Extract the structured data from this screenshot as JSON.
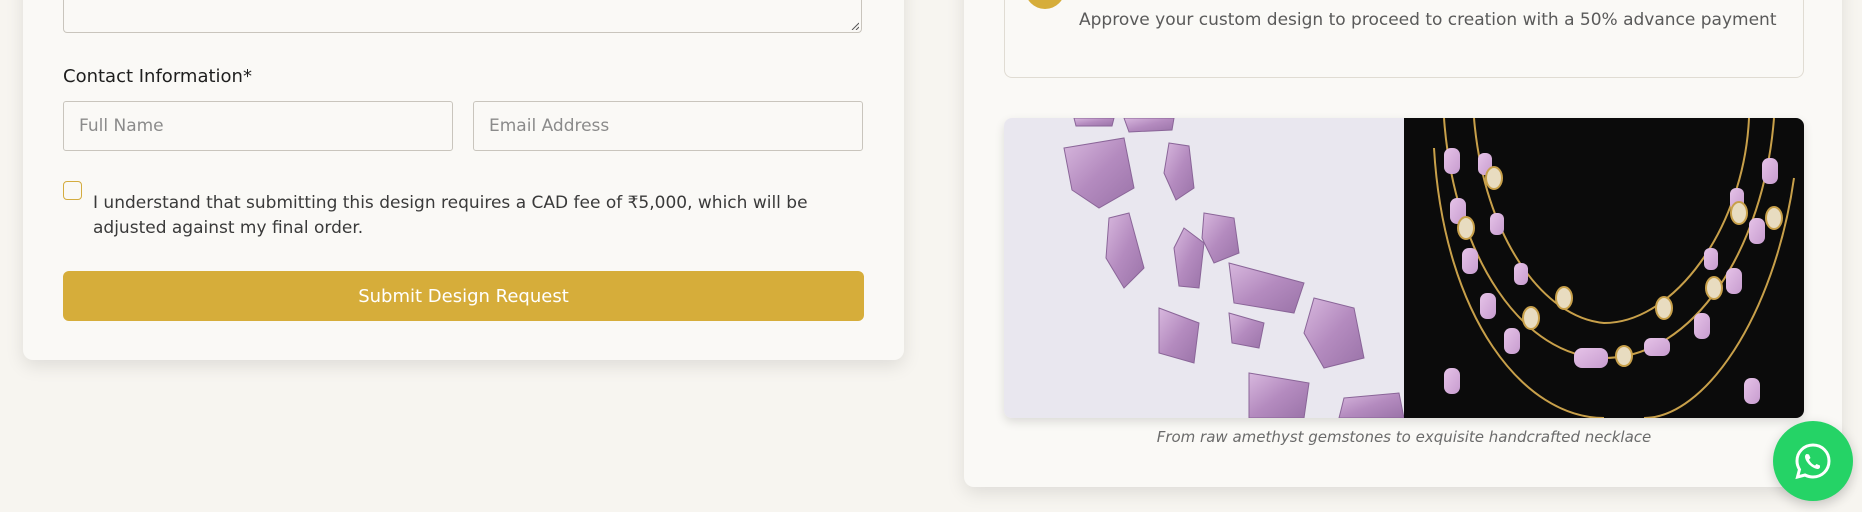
{
  "form": {
    "contact_label": "Contact Information*",
    "name_placeholder": "Full Name",
    "email_placeholder": "Email Address",
    "consent_text": "I understand that submitting this design requires a CAD fee of ₹5,000, which will be adjusted against my final order.",
    "submit_label": "Submit Design Request"
  },
  "info": {
    "step_text": "Approve your custom design to proceed to creation with a 50% advance payment",
    "caption": "From raw amethyst gemstones to exquisite handcrafted necklace"
  },
  "colors": {
    "accent": "#d6ad3a",
    "background": "#f7f5f0",
    "whatsapp": "#25d366"
  },
  "icons": {
    "fab": "whatsapp-icon"
  }
}
